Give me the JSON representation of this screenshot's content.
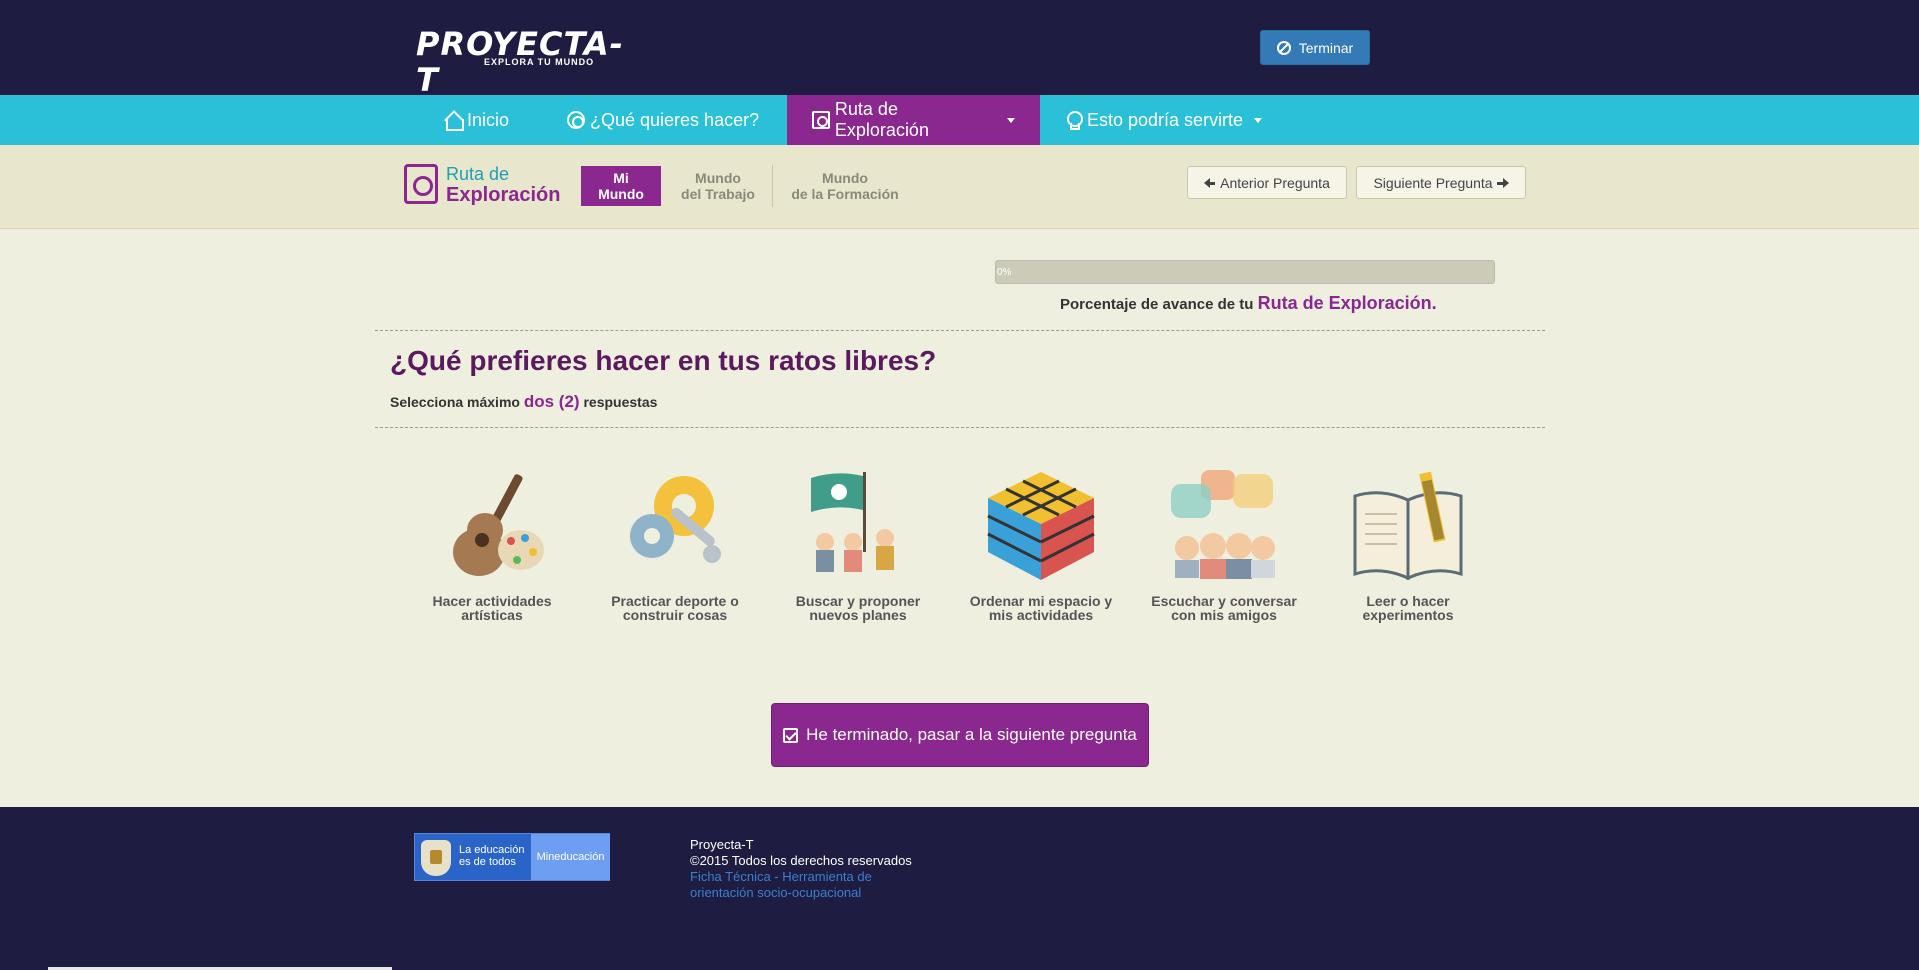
{
  "header": {
    "logo_text": "PROYECTA-T",
    "logo_tagline": "EXPLORA TU MUNDO",
    "terminate_button": "Terminar"
  },
  "nav": {
    "items": [
      {
        "label": "Inicio",
        "icon": "home-icon"
      },
      {
        "label": "¿Qué quieres hacer?",
        "icon": "target-icon"
      },
      {
        "label": "Ruta de Exploración",
        "icon": "search-doc-icon",
        "active": true,
        "dropdown": true
      },
      {
        "label": "Esto podría servirte",
        "icon": "bulb-icon",
        "dropdown": true
      }
    ]
  },
  "route": {
    "title_line1": "Ruta de",
    "title_line2": "Exploración",
    "steps": [
      {
        "line1": "Mi",
        "line2": "Mundo",
        "active": true
      },
      {
        "line1": "Mundo",
        "line2": "del Trabajo"
      },
      {
        "line1": "Mundo",
        "line2": "de la Formación"
      }
    ],
    "prev_button": "Anterior Pregunta",
    "next_button": "Siguiente Pregunta"
  },
  "progress": {
    "value_percent": 0,
    "label": "0%",
    "caption_prefix": "Porcentaje de avance de tu",
    "caption_highlight": "Ruta de Exploración."
  },
  "question": {
    "title": "¿Qué prefieres hacer en tus ratos libres?",
    "hint_prefix": "Selecciona máximo",
    "hint_highlight": "dos (2)",
    "hint_suffix": "respuestas"
  },
  "options": [
    {
      "line1": "Hacer actividades",
      "line2": "artísticas",
      "icon": "guitar-palette-icon"
    },
    {
      "line1": "Practicar deporte o",
      "line2": "construir cosas",
      "icon": "gears-wrench-icon"
    },
    {
      "line1": "Buscar y proponer",
      "line2": "nuevos planes",
      "icon": "explorers-flag-icon"
    },
    {
      "line1": "Ordenar mi espacio y",
      "line2": "mis actividades",
      "icon": "rubik-cube-icon"
    },
    {
      "line1": "Escuchar y conversar",
      "line2": "con mis amigos",
      "icon": "friends-chat-icon"
    },
    {
      "line1": "Leer o hacer",
      "line2": "experimentos",
      "icon": "book-pencil-icon"
    }
  ],
  "finish_button": "He terminado, pasar a la siguiente pregunta",
  "footer": {
    "ministry_text": "La educación es de todos",
    "ministry_name": "Mineducación",
    "site_name": "Proyecta-T",
    "copyright": "©2015 Todos los derechos reservados",
    "link_line1": "Ficha Técnica - Herramienta de",
    "link_line2": "orientación socio-ocupacional"
  },
  "colors": {
    "header_bg": "#1e1c40",
    "nav_bg": "#29c0d8",
    "accent_purple": "#8b2890",
    "page_bg": "#efefe0",
    "button_blue": "#337ab7"
  }
}
